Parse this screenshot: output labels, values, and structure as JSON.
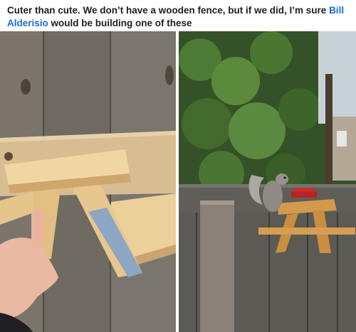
{
  "post": {
    "caption_before": "Cuter than cute.  We don’t have a wooden fence, but if we did, I’m sure ",
    "mention": "Bill Alderisio",
    "caption_after": " would be building one of these"
  },
  "photos": [
    {
      "subject": "squirrel-picnic-table-held-against-fence"
    },
    {
      "subject": "squirrel-eating-at-picnic-table-on-fence"
    }
  ],
  "colors": {
    "caption_text": "#1c1e21",
    "mention": "#1a6ed8",
    "fence_gray": "#6e6961",
    "pine": "#e9c98f",
    "ivy": "#3d5a2e"
  }
}
